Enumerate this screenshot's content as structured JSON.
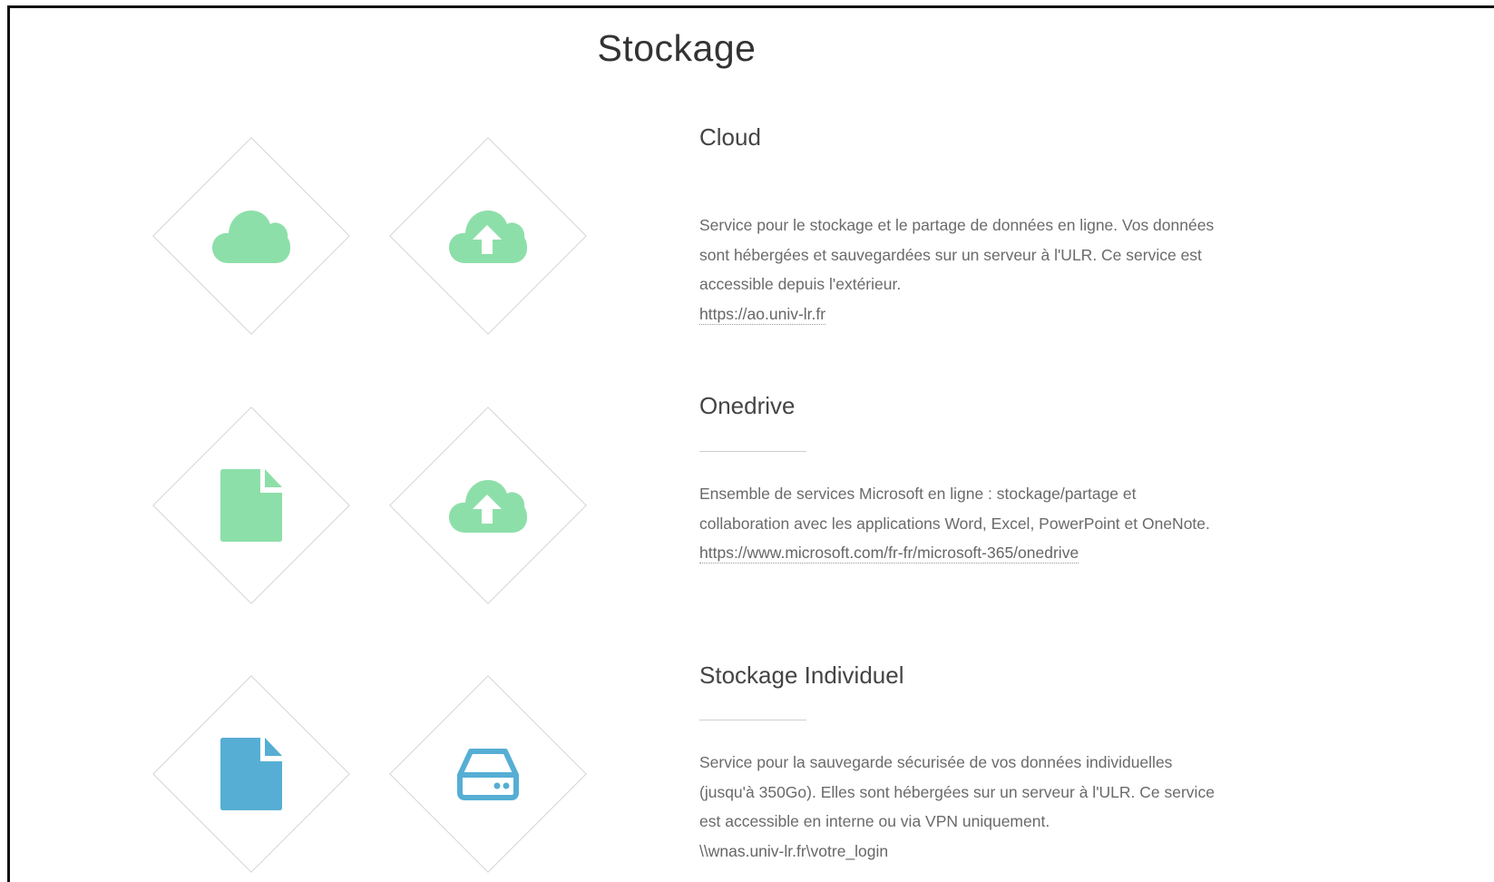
{
  "page": {
    "title": "Stockage"
  },
  "colors": {
    "green": "#8ddfa9",
    "blue": "#56aed4"
  },
  "sections": [
    {
      "title": "Cloud",
      "icons": [
        "cloud-icon",
        "cloud-upload-icon"
      ],
      "description": "Service pour le stockage et le partage de données en ligne. Vos données sont hébergées et sauvegardées sur un serveur à l'ULR. Ce service est accessible depuis l'extérieur.",
      "link": "https://ao.univ-lr.fr"
    },
    {
      "title": "Onedrive",
      "icons": [
        "file-icon",
        "cloud-upload-icon"
      ],
      "description": "Ensemble de services Microsoft en ligne : stockage/partage et collaboration avec les applications Word, Excel, PowerPoint et OneNote.",
      "link": "https://www.microsoft.com/fr-fr/microsoft-365/onedrive"
    },
    {
      "title": "Stockage Individuel",
      "icons": [
        "file-icon",
        "hard-drive-icon"
      ],
      "description": "Service pour la sauvegarde sécurisée de vos données individuelles (jusqu'à 350Go). Elles sont hébergées sur un serveur à l'ULR. Ce service est accessible en interne ou via VPN uniquement.",
      "link": "\\\\wnas.univ-lr.fr\\votre_login"
    }
  ]
}
